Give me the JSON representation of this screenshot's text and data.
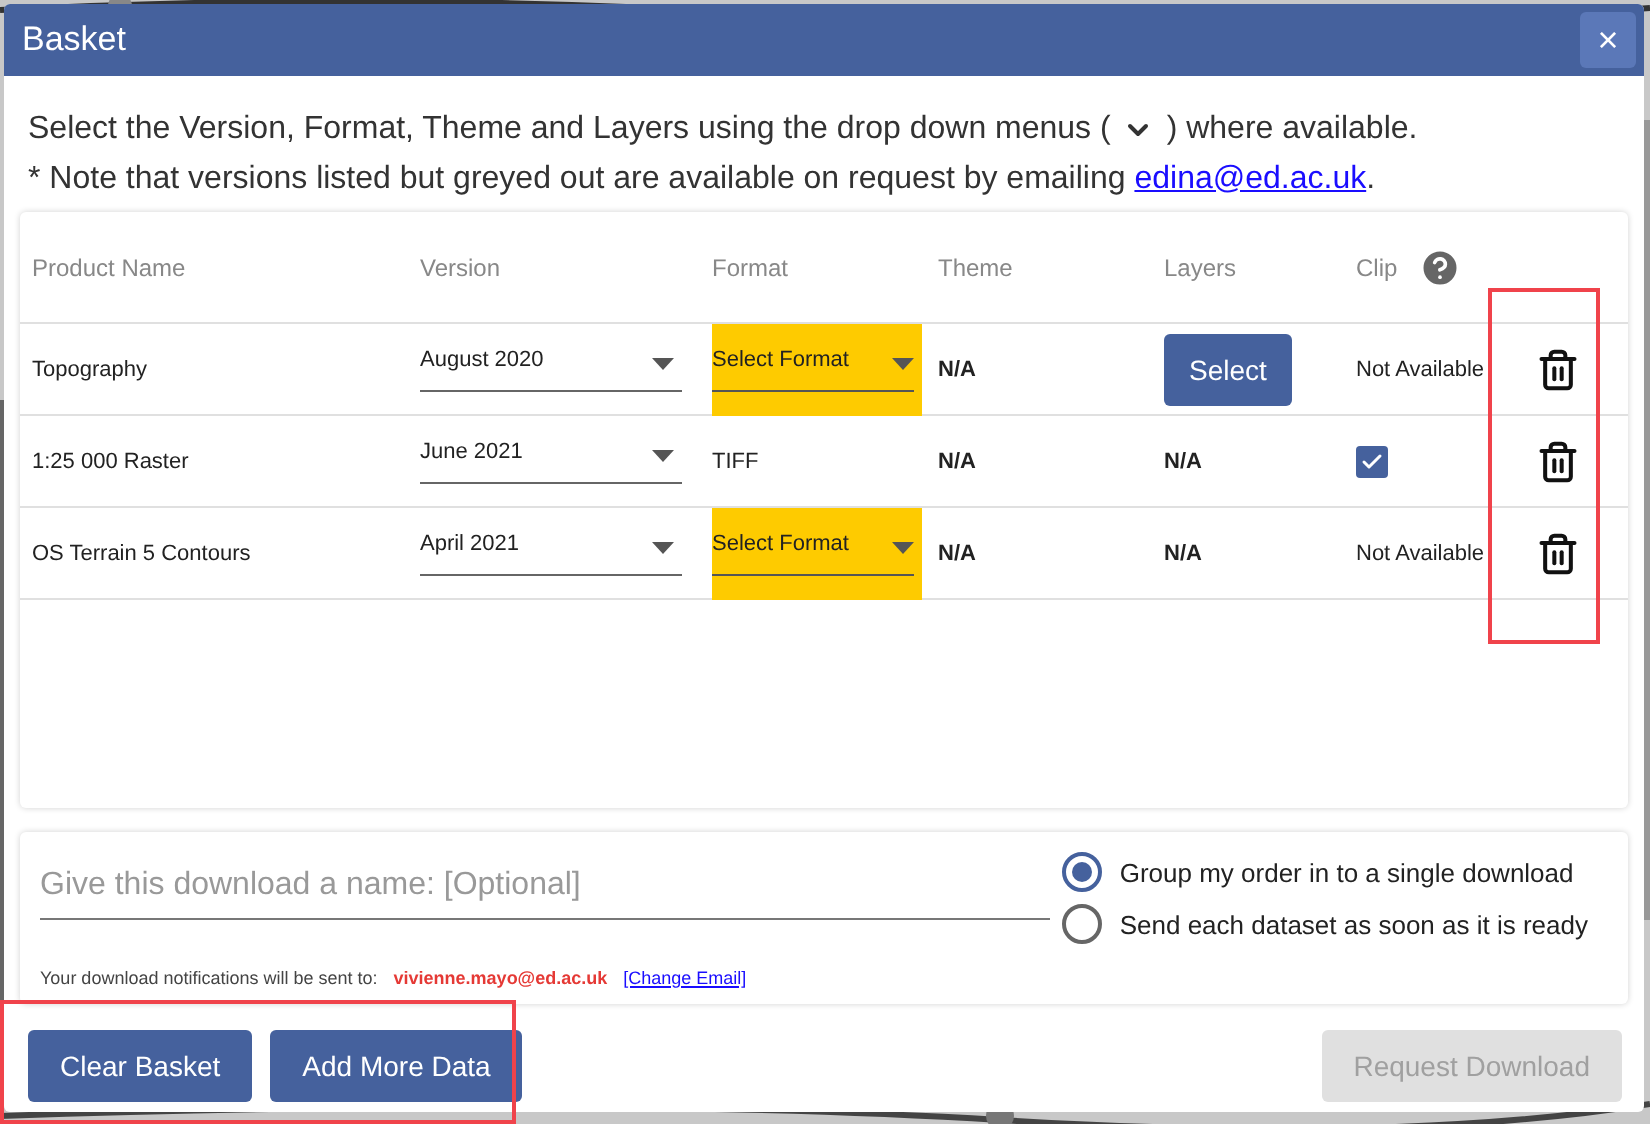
{
  "dialog": {
    "title": "Basket",
    "close": "×"
  },
  "intro": [
    "Select the Version, Format, Theme and Layers using the drop down menus (",
    ") where available."
  ],
  "note": {
    "text": "* Note that versions listed but greyed out are available on request by emailing",
    "link": "edina@ed.ac.uk",
    "end": "."
  },
  "table": {
    "columns": [
      "Product Name",
      "Version",
      "Format",
      "Theme",
      "Layers",
      "Clip"
    ],
    "rows": [
      {
        "product": "Topography",
        "version": "August 2020",
        "format": {
          "kind": "select",
          "text": "Select Format"
        },
        "theme": "N/A",
        "layers": {
          "kind": "button",
          "text": "Select"
        },
        "clip": {
          "kind": "text",
          "text": "Not Available"
        }
      },
      {
        "product": "1:25 000 Raster",
        "version": "June 2021",
        "format": {
          "kind": "text",
          "text": "TIFF"
        },
        "theme": "N/A",
        "layers": {
          "kind": "text",
          "text": "N/A"
        },
        "clip": {
          "kind": "checkbox",
          "checked": true
        }
      },
      {
        "product": "OS Terrain 5 Contours",
        "version": "April 2021",
        "format": {
          "kind": "select",
          "text": "Select Format"
        },
        "theme": "N/A",
        "layers": {
          "kind": "text",
          "text": "N/A"
        },
        "clip": {
          "kind": "text",
          "text": "Not Available"
        }
      }
    ]
  },
  "download_name": {
    "placeholder": "Give this download a name: [Optional]"
  },
  "delivery": [
    {
      "label": "Group my order in to a single download",
      "selected": true
    },
    {
      "label": "Send each dataset as soon as it is ready",
      "selected": false
    }
  ],
  "notification": {
    "text": "Your download notifications will be sent to:",
    "email": "vivienne.mayo@ed.ac.uk",
    "link": "[Change Email]"
  },
  "buttons": [
    {
      "label": "Clear Basket",
      "disabled": false
    },
    {
      "label": "Add More Data",
      "disabled": false
    },
    {
      "label": "Request Download",
      "disabled": true
    }
  ]
}
